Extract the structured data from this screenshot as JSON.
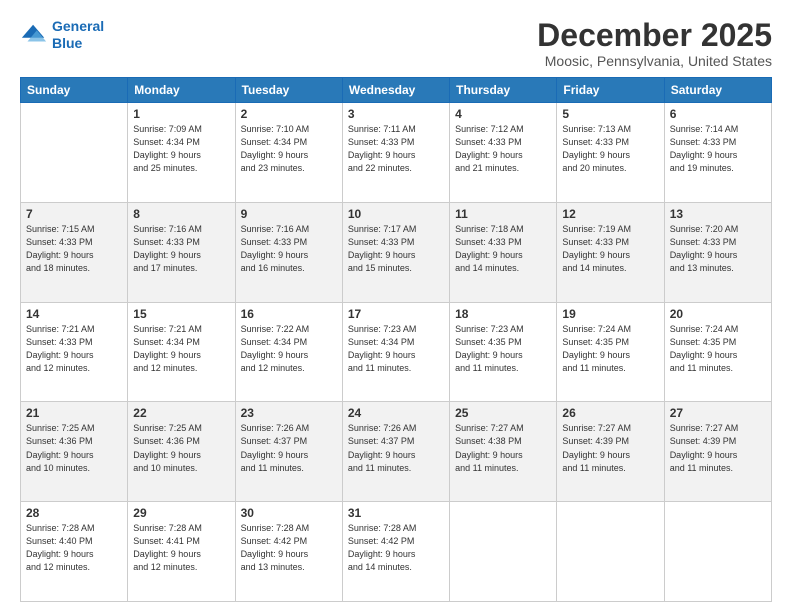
{
  "header": {
    "logo_line1": "General",
    "logo_line2": "Blue",
    "month_title": "December 2025",
    "location": "Moosic, Pennsylvania, United States"
  },
  "days_of_week": [
    "Sunday",
    "Monday",
    "Tuesday",
    "Wednesday",
    "Thursday",
    "Friday",
    "Saturday"
  ],
  "weeks": [
    [
      {
        "day": "",
        "info": ""
      },
      {
        "day": "1",
        "info": "Sunrise: 7:09 AM\nSunset: 4:34 PM\nDaylight: 9 hours\nand 25 minutes."
      },
      {
        "day": "2",
        "info": "Sunrise: 7:10 AM\nSunset: 4:34 PM\nDaylight: 9 hours\nand 23 minutes."
      },
      {
        "day": "3",
        "info": "Sunrise: 7:11 AM\nSunset: 4:33 PM\nDaylight: 9 hours\nand 22 minutes."
      },
      {
        "day": "4",
        "info": "Sunrise: 7:12 AM\nSunset: 4:33 PM\nDaylight: 9 hours\nand 21 minutes."
      },
      {
        "day": "5",
        "info": "Sunrise: 7:13 AM\nSunset: 4:33 PM\nDaylight: 9 hours\nand 20 minutes."
      },
      {
        "day": "6",
        "info": "Sunrise: 7:14 AM\nSunset: 4:33 PM\nDaylight: 9 hours\nand 19 minutes."
      }
    ],
    [
      {
        "day": "7",
        "info": "Sunrise: 7:15 AM\nSunset: 4:33 PM\nDaylight: 9 hours\nand 18 minutes."
      },
      {
        "day": "8",
        "info": "Sunrise: 7:16 AM\nSunset: 4:33 PM\nDaylight: 9 hours\nand 17 minutes."
      },
      {
        "day": "9",
        "info": "Sunrise: 7:16 AM\nSunset: 4:33 PM\nDaylight: 9 hours\nand 16 minutes."
      },
      {
        "day": "10",
        "info": "Sunrise: 7:17 AM\nSunset: 4:33 PM\nDaylight: 9 hours\nand 15 minutes."
      },
      {
        "day": "11",
        "info": "Sunrise: 7:18 AM\nSunset: 4:33 PM\nDaylight: 9 hours\nand 14 minutes."
      },
      {
        "day": "12",
        "info": "Sunrise: 7:19 AM\nSunset: 4:33 PM\nDaylight: 9 hours\nand 14 minutes."
      },
      {
        "day": "13",
        "info": "Sunrise: 7:20 AM\nSunset: 4:33 PM\nDaylight: 9 hours\nand 13 minutes."
      }
    ],
    [
      {
        "day": "14",
        "info": "Sunrise: 7:21 AM\nSunset: 4:33 PM\nDaylight: 9 hours\nand 12 minutes."
      },
      {
        "day": "15",
        "info": "Sunrise: 7:21 AM\nSunset: 4:34 PM\nDaylight: 9 hours\nand 12 minutes."
      },
      {
        "day": "16",
        "info": "Sunrise: 7:22 AM\nSunset: 4:34 PM\nDaylight: 9 hours\nand 12 minutes."
      },
      {
        "day": "17",
        "info": "Sunrise: 7:23 AM\nSunset: 4:34 PM\nDaylight: 9 hours\nand 11 minutes."
      },
      {
        "day": "18",
        "info": "Sunrise: 7:23 AM\nSunset: 4:35 PM\nDaylight: 9 hours\nand 11 minutes."
      },
      {
        "day": "19",
        "info": "Sunrise: 7:24 AM\nSunset: 4:35 PM\nDaylight: 9 hours\nand 11 minutes."
      },
      {
        "day": "20",
        "info": "Sunrise: 7:24 AM\nSunset: 4:35 PM\nDaylight: 9 hours\nand 11 minutes."
      }
    ],
    [
      {
        "day": "21",
        "info": "Sunrise: 7:25 AM\nSunset: 4:36 PM\nDaylight: 9 hours\nand 10 minutes."
      },
      {
        "day": "22",
        "info": "Sunrise: 7:25 AM\nSunset: 4:36 PM\nDaylight: 9 hours\nand 10 minutes."
      },
      {
        "day": "23",
        "info": "Sunrise: 7:26 AM\nSunset: 4:37 PM\nDaylight: 9 hours\nand 11 minutes."
      },
      {
        "day": "24",
        "info": "Sunrise: 7:26 AM\nSunset: 4:37 PM\nDaylight: 9 hours\nand 11 minutes."
      },
      {
        "day": "25",
        "info": "Sunrise: 7:27 AM\nSunset: 4:38 PM\nDaylight: 9 hours\nand 11 minutes."
      },
      {
        "day": "26",
        "info": "Sunrise: 7:27 AM\nSunset: 4:39 PM\nDaylight: 9 hours\nand 11 minutes."
      },
      {
        "day": "27",
        "info": "Sunrise: 7:27 AM\nSunset: 4:39 PM\nDaylight: 9 hours\nand 11 minutes."
      }
    ],
    [
      {
        "day": "28",
        "info": "Sunrise: 7:28 AM\nSunset: 4:40 PM\nDaylight: 9 hours\nand 12 minutes."
      },
      {
        "day": "29",
        "info": "Sunrise: 7:28 AM\nSunset: 4:41 PM\nDaylight: 9 hours\nand 12 minutes."
      },
      {
        "day": "30",
        "info": "Sunrise: 7:28 AM\nSunset: 4:42 PM\nDaylight: 9 hours\nand 13 minutes."
      },
      {
        "day": "31",
        "info": "Sunrise: 7:28 AM\nSunset: 4:42 PM\nDaylight: 9 hours\nand 14 minutes."
      },
      {
        "day": "",
        "info": ""
      },
      {
        "day": "",
        "info": ""
      },
      {
        "day": "",
        "info": ""
      }
    ]
  ]
}
